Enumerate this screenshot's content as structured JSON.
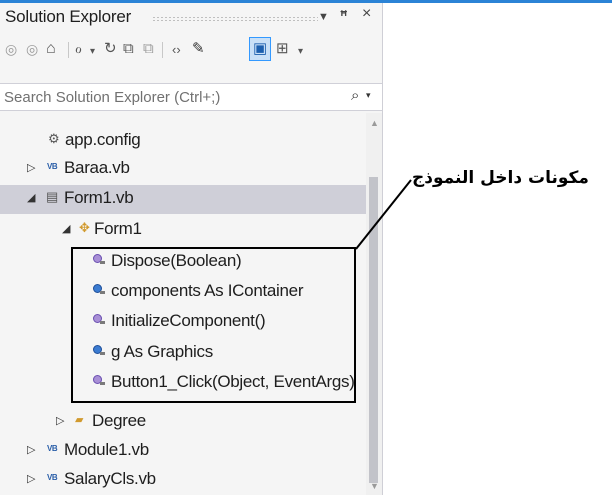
{
  "panel": {
    "title": "Solution Explorer",
    "title_buttons": {
      "dropdown": "▾",
      "pin": "ᵃ",
      "close": "×"
    }
  },
  "toolbar": {
    "buttons": [
      {
        "name": "back",
        "glyph": "◉"
      },
      {
        "name": "forward",
        "glyph": "◉"
      },
      {
        "name": "home",
        "glyph": "⌂"
      },
      {
        "name": "pending-changes",
        "glyph": "⟳"
      },
      {
        "name": "sync",
        "glyph": "⟲"
      },
      {
        "name": "collapse-all",
        "glyph": "⧉"
      },
      {
        "name": "show-all-files",
        "glyph": "⧉"
      },
      {
        "name": "view-code",
        "glyph": "‹›"
      },
      {
        "name": "properties",
        "glyph": "✎"
      },
      {
        "name": "preview",
        "glyph": "▣"
      },
      {
        "name": "class-diagram",
        "glyph": "⊞"
      },
      {
        "name": "more",
        "glyph": "▾"
      }
    ]
  },
  "search": {
    "placeholder": "Search Solution Explorer (Ctrl+;)"
  },
  "tree": {
    "items": [
      {
        "label": "app.config",
        "icon": "config-file-icon",
        "indent": 1
      },
      {
        "label": "Baraa.vb",
        "icon": "vb-file-icon",
        "indent": 0,
        "collapsed": true
      },
      {
        "label": "Form1.vb",
        "icon": "form-file-icon",
        "indent": 0,
        "expanded": true,
        "selected": true
      },
      {
        "label": "Form1",
        "icon": "class-icon",
        "indent": 1,
        "expanded": true
      },
      {
        "label": "Dispose(Boolean)",
        "icon": "method-icon",
        "indent": 2
      },
      {
        "label": "components As IContainer",
        "icon": "field-icon",
        "indent": 2
      },
      {
        "label": "InitializeComponent()",
        "icon": "method-icon",
        "indent": 2
      },
      {
        "label": "g As Graphics",
        "icon": "field-icon",
        "indent": 2
      },
      {
        "label": "Button1_Click(Object, EventArgs)",
        "icon": "method-icon",
        "indent": 2
      },
      {
        "label": "Degree",
        "icon": "enum-icon",
        "indent": 1,
        "collapsed": true
      },
      {
        "label": "Module1.vb",
        "icon": "vb-file-icon",
        "indent": 0,
        "collapsed": true
      },
      {
        "label": "SalaryCls.vb",
        "icon": "vb-file-icon",
        "indent": 0,
        "collapsed": true
      }
    ]
  },
  "annotation": {
    "text": "مكونات داخل النموذج"
  },
  "colors": {
    "accent": "#2b83d6",
    "selection": "#cfcfd8",
    "panel_bg": "#f5f5f5",
    "vb_badge": "#2a5ea8",
    "class_icon": "#d19a2e"
  }
}
